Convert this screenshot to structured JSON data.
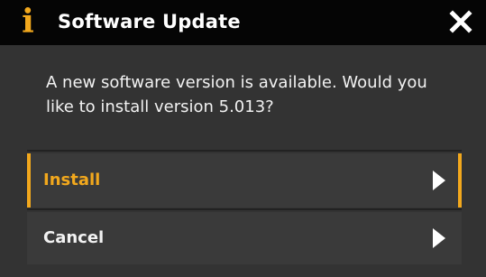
{
  "dialog": {
    "title": "Software Update",
    "message": "A new software version is available. Would you like to install version 5.013?",
    "icons": {
      "info": "info-icon",
      "close": "close-icon",
      "arrow": "chevron-right-icon"
    },
    "options": [
      {
        "label": "Install",
        "selected": true
      },
      {
        "label": "Cancel",
        "selected": false
      }
    ],
    "colors": {
      "accent": "#f2a81d",
      "title_bar": "#050505",
      "background": "#333333",
      "text": "#f2f2f2"
    }
  }
}
